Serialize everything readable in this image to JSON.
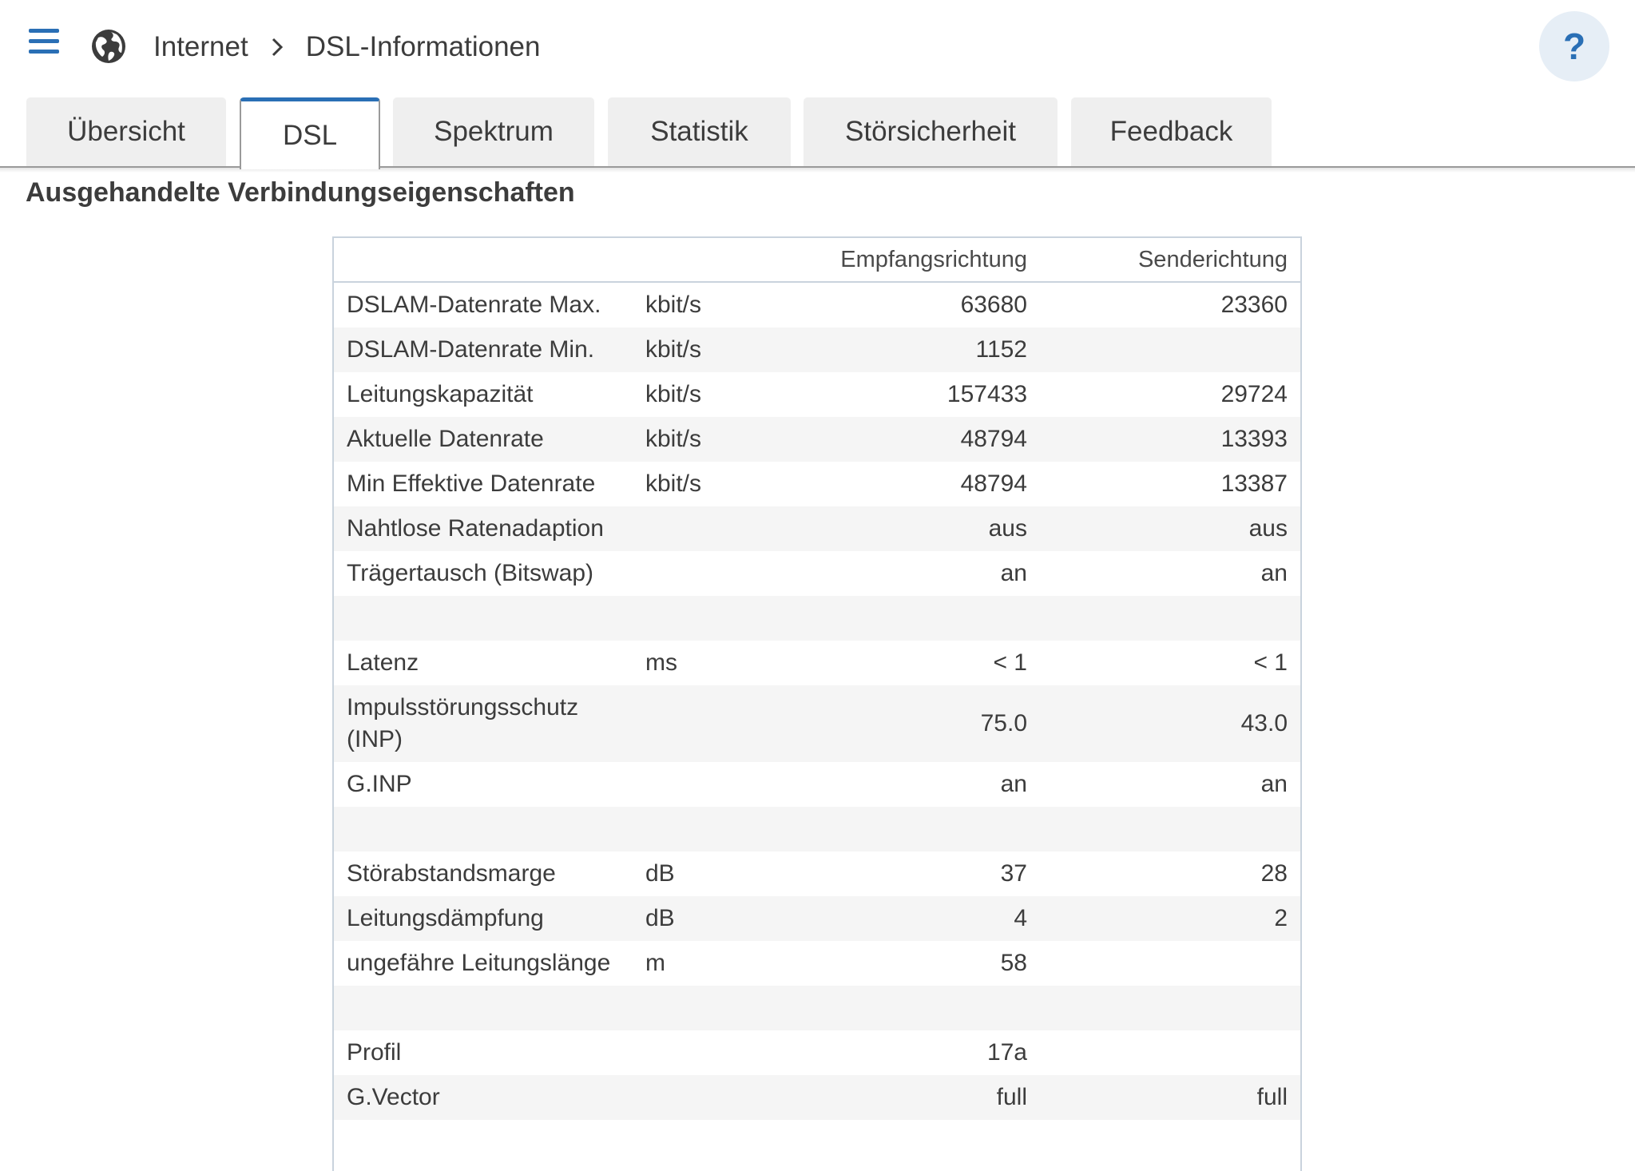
{
  "header": {
    "breadcrumb": [
      "Internet",
      "DSL-Informationen"
    ],
    "help_label": "?"
  },
  "tabs": [
    {
      "label": "Übersicht",
      "active": false
    },
    {
      "label": "DSL",
      "active": true
    },
    {
      "label": "Spektrum",
      "active": false
    },
    {
      "label": "Statistik",
      "active": false
    },
    {
      "label": "Störsicherheit",
      "active": false
    },
    {
      "label": "Feedback",
      "active": false
    }
  ],
  "section_title": "Ausgehandelte Verbindungseigenschaften",
  "table": {
    "columns": [
      "",
      "",
      "Empfangsrichtung",
      "Senderichtung"
    ],
    "rows": [
      {
        "label": "DSLAM-Datenrate Max.",
        "unit": "kbit/s",
        "rx": "63680",
        "tx": "23360"
      },
      {
        "label": "DSLAM-Datenrate Min.",
        "unit": "kbit/s",
        "rx": "1152",
        "tx": ""
      },
      {
        "label": "Leitungskapazität",
        "unit": "kbit/s",
        "rx": "157433",
        "tx": "29724"
      },
      {
        "label": "Aktuelle Datenrate",
        "unit": "kbit/s",
        "rx": "48794",
        "tx": "13393"
      },
      {
        "label": "Min Effektive Datenrate",
        "unit": "kbit/s",
        "rx": "48794",
        "tx": "13387"
      },
      {
        "label": "Nahtlose Ratenadaption",
        "unit": "",
        "rx": "aus",
        "tx": "aus"
      },
      {
        "label": "Trägertausch (Bitswap)",
        "unit": "",
        "rx": "an",
        "tx": "an"
      },
      {
        "label": "",
        "unit": "",
        "rx": "",
        "tx": ""
      },
      {
        "label": "Latenz",
        "unit": "ms",
        "rx": "< 1",
        "tx": "< 1"
      },
      {
        "label": "Impulsstörungsschutz (INP)",
        "unit": "",
        "rx": "75.0",
        "tx": "43.0"
      },
      {
        "label": "G.INP",
        "unit": "",
        "rx": "an",
        "tx": "an"
      },
      {
        "label": "",
        "unit": "",
        "rx": "",
        "tx": ""
      },
      {
        "label": "Störabstandsmarge",
        "unit": "dB",
        "rx": "37",
        "tx": "28"
      },
      {
        "label": "Leitungsdämpfung",
        "unit": "dB",
        "rx": "4",
        "tx": "2"
      },
      {
        "label": "ungefähre Leitungslänge",
        "unit": "m",
        "rx": "58",
        "tx": ""
      },
      {
        "label": "",
        "unit": "",
        "rx": "",
        "tx": ""
      },
      {
        "label": "Profil",
        "unit": "",
        "rx": "17a",
        "tx": ""
      },
      {
        "label": "G.Vector",
        "unit": "",
        "rx": "full",
        "tx": "full"
      }
    ]
  }
}
